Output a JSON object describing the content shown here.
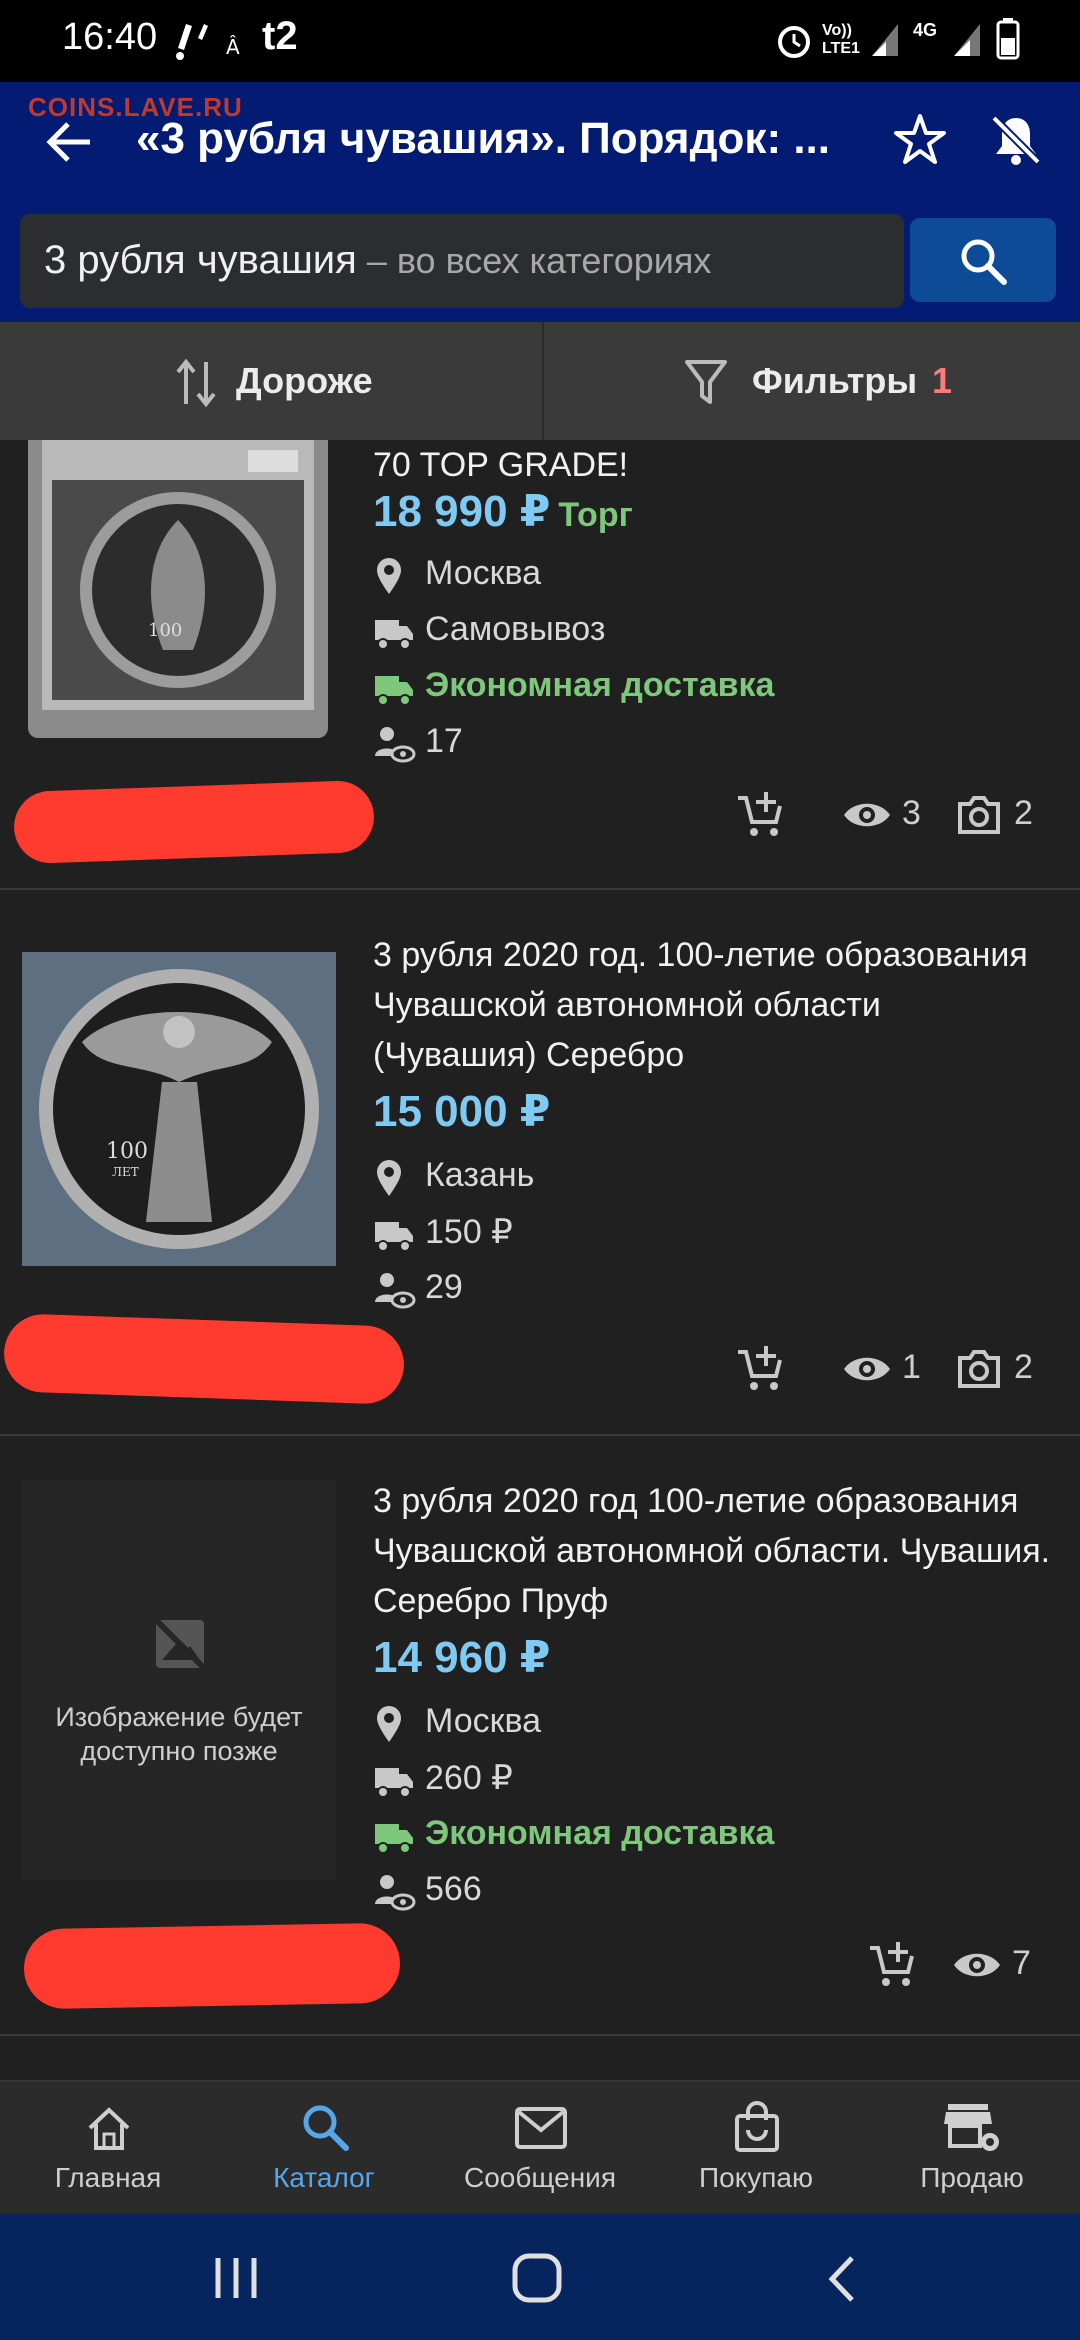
{
  "status_bar": {
    "time": "16:40",
    "carrier": "t2",
    "net_label": "Vo))\nLTE1",
    "net_type": "4G"
  },
  "app_bar": {
    "watermark": "COINS.LAVE.RU",
    "title": "«3 рубля чувашия». Порядок: ..."
  },
  "search": {
    "query": "3 рубля чувашия",
    "scope": " – во всех категориях"
  },
  "sort_bar": {
    "sort_label": "Дороже",
    "filter_label": "Фильтры",
    "filter_count": "1"
  },
  "listings": [
    {
      "title": "70 TOP GRADE!",
      "price": "18 990 ₽",
      "badge": "Торг",
      "city": "Москва",
      "delivery": "Самовывоз",
      "delivery2": "Экономная доставка",
      "buyers": "17",
      "views": "3",
      "photos": "2"
    },
    {
      "title": "3 рубля 2020 год. 100-летие образования Чувашской автономной области (Чувашия) Серебро",
      "price": "15 000 ₽",
      "city": "Казань",
      "delivery": "150 ₽",
      "buyers": "29",
      "views": "1",
      "photos": "2"
    },
    {
      "title": "3 рубля 2020 год 100-летие образования Чувашской автономной области. Чувашия. Серебро Пруф",
      "price": "14 960 ₽",
      "placeholder": "Изображение будет доступно позже",
      "city": "Москва",
      "delivery": "260 ₽",
      "delivery2": "Экономная доставка",
      "buyers": "566",
      "views": "7"
    }
  ],
  "bottom_nav": [
    {
      "label": "Главная",
      "icon": "home-icon"
    },
    {
      "label": "Каталог",
      "icon": "search-icon",
      "active": true
    },
    {
      "label": "Сообщения",
      "icon": "mail-icon"
    },
    {
      "label": "Покупаю",
      "icon": "shopping-bag-icon"
    },
    {
      "label": "Продаю",
      "icon": "store-settings-icon"
    }
  ],
  "colors": {
    "app_bar": "#031b73",
    "price": "#7fcaf2",
    "green": "#7ec87c",
    "active_nav": "#58a6ea",
    "redaction": "#ff3b30"
  }
}
